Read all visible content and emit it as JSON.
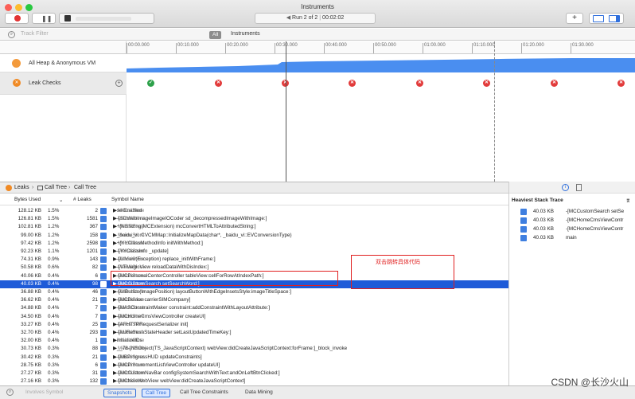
{
  "window": {
    "title": "Instruments",
    "run_label": "Run 2 of 2",
    "elapsed": "00:02:02"
  },
  "toolbar": {
    "add_label": "+"
  },
  "filter": {
    "placeholder": "Track Filter",
    "all_label": "All",
    "instruments_label": "Instruments"
  },
  "ruler": {
    "ticks": [
      "00:00.000",
      "00:10.000",
      "00:20.000",
      "00:30.000",
      "00:40.000",
      "00:50.000",
      "01:00.000",
      "01:10.000",
      "01:20.000",
      "01:30.000"
    ]
  },
  "tracks": {
    "heap": "All Heap & Anonymous VM",
    "leaks": "Leak Checks"
  },
  "leak_checks": [
    {
      "status": "ok"
    },
    {
      "status": "leak"
    },
    {
      "status": "leak"
    },
    {
      "status": "leak"
    },
    {
      "status": "leak"
    },
    {
      "status": "leak"
    },
    {
      "status": "leak"
    },
    {
      "status": "leak"
    }
  ],
  "bottom": {
    "crumbs": [
      "Leaks",
      "Call Tree",
      "Call Tree"
    ]
  },
  "columns": {
    "bytes": "Bytes Used",
    "leaks": "# Leaks",
    "symbol": "Symbol Name"
  },
  "annotation": "双击跳转具体代码",
  "rows": [
    {
      "bytes": "128.12 KB",
      "pct": "1.5%",
      "n": "2",
      "sym": "▶setEnabled",
      "lib": "MeicaiStore"
    },
    {
      "bytes": "126.81 KB",
      "pct": "1.5%",
      "n": "1581",
      "sym": "▶-[SDWebImageImageIOCoder sd_decompressedImageWithImage:]",
      "lib": "MeicaiStore"
    },
    {
      "bytes": "102.81 KB",
      "pct": "1.2%",
      "n": "367",
      "sym": "▶+[NSString(MCExtension) mcConvertHTMLToAttributedString:]",
      "lib": "MeicaiStore"
    },
    {
      "bytes": "99.00 KB",
      "pct": "1.2%",
      "n": "158",
      "sym": "▶_baidu_vi::CVCMMap::InitializeMapData(char*, _baidu_vi::EVConversionType)",
      "lib": "MeicaiStore"
    },
    {
      "bytes": "97.42 KB",
      "pct": "1.2%",
      "n": "2598",
      "sym": "▶+[YYClassMethodInfo initWithMethod:]",
      "lib": "MeicaiStore"
    },
    {
      "bytes": "92.23 KB",
      "pct": "1.1%",
      "n": "1201",
      "sym": "▶-[YYClassInfo _update]",
      "lib": "MeicaiStore"
    },
    {
      "bytes": "74.31 KB",
      "pct": "0.9%",
      "n": "143",
      "sym": "▶-[UIView(Exception) replace_initWithFrame:]",
      "lib": "MeicaiStore"
    },
    {
      "bytes": "50.58 KB",
      "pct": "0.6%",
      "n": "82",
      "sym": "▶-[VTMagicView reloadDataWithDisIndex:]",
      "lib": "MeicaiStore"
    },
    {
      "bytes": "40.06 KB",
      "pct": "0.4%",
      "n": "6",
      "sym": "▶-[MCPersonalCenterController tableView:cellForRowAtIndexPath:]",
      "lib": "MeicaiStore"
    },
    {
      "bytes": "40.03 KB",
      "pct": "0.4%",
      "n": "98",
      "sym": "▶-[MCCustomSearch setSearchWord:]",
      "lib": "MeicaiStore"
    },
    {
      "bytes": "36.88 KB",
      "pct": "0.4%",
      "n": "46",
      "sym": "▶-[UIButton(ImagePosition) layoutButtonWithEdgeInsetsStyle:imageTitleSpace:]",
      "lib": "MeicaiStore"
    },
    {
      "bytes": "36.62 KB",
      "pct": "0.4%",
      "n": "21",
      "sym": "▶-[MCDevice carrierSIMCompany]",
      "lib": "MeicaiStore"
    },
    {
      "bytes": "34.88 KB",
      "pct": "0.4%",
      "n": "7",
      "sym": "▶-[MASConstraintMaker constraint:addConstraintWithLayoutAttribute:]",
      "lib": "MeicaiStore"
    },
    {
      "bytes": "34.50 KB",
      "pct": "0.4%",
      "n": "7",
      "sym": "▶-[MCHomeCmsViewController createUI]",
      "lib": "MeicaiStore"
    },
    {
      "bytes": "33.27 KB",
      "pct": "0.4%",
      "n": "25",
      "sym": "▶-[AFHTTPRequestSerializer init]",
      "lib": "MeicaiStore"
    },
    {
      "bytes": "32.70 KB",
      "pct": "0.4%",
      "n": "293",
      "sym": "▶-[MJRefreshStateHeader setLastUpdatedTimeKey:]",
      "lib": "MeicaiStore"
    },
    {
      "bytes": "32.00 KB",
      "pct": "0.4%",
      "n": "1",
      "sym": "▶initializeIDs",
      "lib": "MeicaiStore"
    },
    {
      "bytes": "30.73 KB",
      "pct": "0.3%",
      "n": "88",
      "sym": "▶__78-[NSObject(TS_JavaScriptContext) webView:didCreateJavaScriptContext:forFrame:]_block_invoke",
      "lib": "MeicaiStore"
    },
    {
      "bytes": "30.42 KB",
      "pct": "0.3%",
      "n": "21",
      "sym": "▶-[MBProgressHUD updateConstraints]",
      "lib": "MeicaiStore"
    },
    {
      "bytes": "28.75 KB",
      "pct": "0.3%",
      "n": "6",
      "sym": "▶-[MCProcurementListViewController updateUI]",
      "lib": "MeicaiStore"
    },
    {
      "bytes": "27.27 KB",
      "pct": "0.3%",
      "n": "31",
      "sym": "▶-[MCCustomNavBar configSystemSearchWithText:andOnLeftBtnClicked:]",
      "lib": "MeicaiStore"
    },
    {
      "bytes": "27.16 KB",
      "pct": "0.3%",
      "n": "132",
      "sym": "▶-[MCNewWebView webView:didCreateJavaScriptContext]",
      "lib": "MeicaiStore"
    }
  ],
  "right": {
    "title": "Heaviest Stack Trace",
    "rows": [
      {
        "size": "40.03 KB",
        "sym": "-[MCCustomSearch setSe"
      },
      {
        "size": "40.03 KB",
        "sym": "-[MCHomeCmsViewContr"
      },
      {
        "size": "40.03 KB",
        "sym": "-[MCHomeCmsViewContr"
      },
      {
        "size": "40.03 KB",
        "sym": "main"
      }
    ]
  },
  "footer": {
    "placeholder": "Involves Symbol",
    "tabs": [
      "Snapshots",
      "Call Tree",
      "Call Tree Constraints",
      "Data Mining"
    ]
  },
  "watermark": "CSDN @长沙火山",
  "colors": {
    "accent": "#1e5bd8",
    "heap": "#4a8ef0",
    "leak": "#e23b3b",
    "ok": "#2da14a"
  }
}
